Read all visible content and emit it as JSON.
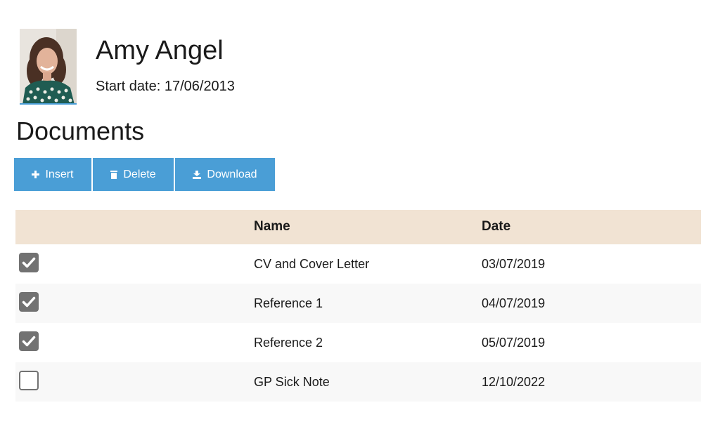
{
  "profile": {
    "name": "Amy Angel",
    "start_date": "Start date: 17/06/2013"
  },
  "documents": {
    "title": "Documents",
    "toolbar": {
      "insert_label": "Insert",
      "delete_label": "Delete",
      "download_label": "Download"
    },
    "columns": {
      "select": "",
      "name": "Name",
      "date": "Date"
    },
    "rows": [
      {
        "checked": true,
        "name": "CV and Cover Letter",
        "date": "03/07/2019"
      },
      {
        "checked": true,
        "name": "Reference 1",
        "date": "04/07/2019"
      },
      {
        "checked": true,
        "name": "Reference 2",
        "date": "05/07/2019"
      },
      {
        "checked": false,
        "name": "GP Sick Note",
        "date": "12/10/2022"
      }
    ]
  },
  "colors": {
    "accent": "#4a9ed6",
    "header_bg": "#f1e3d3",
    "alt_row_bg": "#f8f8f8",
    "checkbox": "#727272"
  },
  "icons": {
    "insert": "plus-icon",
    "delete": "trash-icon",
    "download": "download-icon",
    "check": "checkmark-icon"
  }
}
